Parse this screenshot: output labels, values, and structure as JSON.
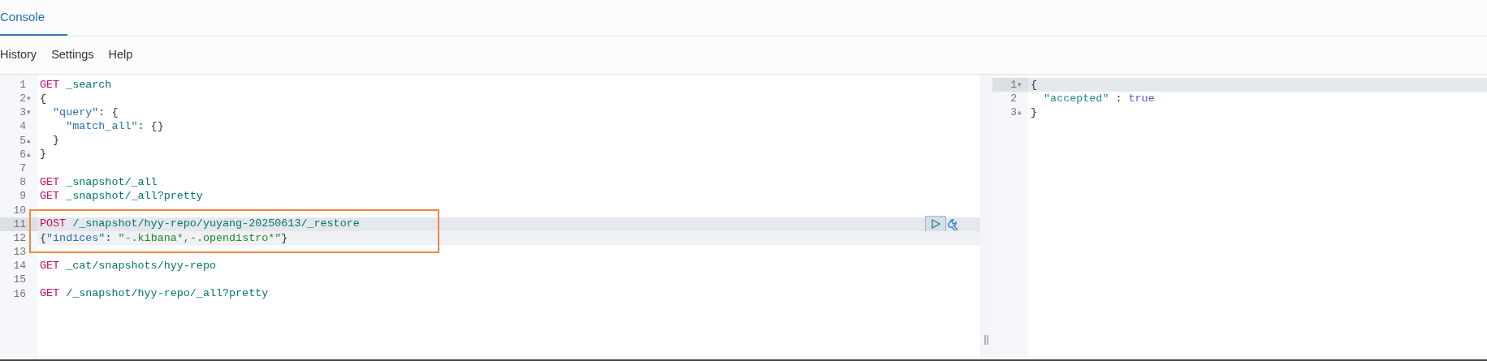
{
  "tabs": [
    {
      "label": "Console",
      "selected": true
    }
  ],
  "menu": [
    "History",
    "Settings",
    "Help"
  ],
  "request_editor": {
    "lines": [
      {
        "number": "1",
        "cursor": false,
        "in_request": false,
        "actions": false,
        "tokens": [
          {
            "kind": "method",
            "text": "GET"
          },
          {
            "kind": "path",
            "text": "_search"
          }
        ]
      },
      {
        "number": "2",
        "fold": "▾",
        "cursor": false,
        "in_request": false,
        "actions": false,
        "tokens": [
          {
            "kind": "punct",
            "text": "{"
          }
        ]
      },
      {
        "number": "3",
        "fold": "▾",
        "cursor": false,
        "in_request": false,
        "actions": false,
        "tokens": [
          {
            "kind": "key",
            "text": "  \"query\""
          },
          {
            "kind": "punct",
            "text": ": {"
          }
        ]
      },
      {
        "number": "4",
        "cursor": false,
        "in_request": false,
        "actions": false,
        "tokens": [
          {
            "kind": "key",
            "text": "    \"match_all\""
          },
          {
            "kind": "punct",
            "text": ": {}"
          }
        ]
      },
      {
        "number": "5",
        "fold": "▴",
        "cursor": false,
        "in_request": false,
        "actions": false,
        "tokens": [
          {
            "kind": "punct",
            "text": "  }"
          }
        ]
      },
      {
        "number": "6",
        "fold": "▴",
        "cursor": false,
        "in_request": false,
        "actions": false,
        "tokens": [
          {
            "kind": "punct",
            "text": "}"
          }
        ]
      },
      {
        "number": "7",
        "cursor": false,
        "in_request": false,
        "actions": false
      },
      {
        "number": "8",
        "cursor": false,
        "in_request": false,
        "actions": false,
        "tokens": [
          {
            "kind": "method",
            "text": "GET"
          },
          {
            "kind": "path",
            "text": "_snapshot/_all"
          }
        ]
      },
      {
        "number": "9",
        "cursor": false,
        "in_request": false,
        "actions": false,
        "tokens": [
          {
            "kind": "method",
            "text": "GET"
          },
          {
            "kind": "path",
            "text": "_snapshot/_all?pretty"
          }
        ]
      },
      {
        "number": "10",
        "cursor": false,
        "in_request": false,
        "actions": false
      },
      {
        "number": "11",
        "cursor": true,
        "in_request": true,
        "actions": true,
        "tokens": [
          {
            "kind": "method",
            "text": "POST"
          },
          {
            "kind": "path",
            "text": "/_snapshot/hyy-repo/yuyang-20250613/_restore"
          }
        ]
      },
      {
        "number": "12",
        "cursor": false,
        "in_request": true,
        "actions": false,
        "tokens": [
          {
            "kind": "punct",
            "text": "{"
          },
          {
            "kind": "key",
            "text": "\"indices\""
          },
          {
            "kind": "punct",
            "text": ": "
          },
          {
            "kind": "string",
            "text": "\"-.kibana*,-.opendistro*\""
          },
          {
            "kind": "punct",
            "text": "}"
          }
        ]
      },
      {
        "number": "13",
        "cursor": false,
        "in_request": false,
        "actions": false
      },
      {
        "number": "14",
        "cursor": false,
        "in_request": false,
        "actions": false,
        "tokens": [
          {
            "kind": "method",
            "text": "GET"
          },
          {
            "kind": "path",
            "text": "_cat/snapshots/hyy-repo"
          }
        ]
      },
      {
        "number": "15",
        "cursor": false,
        "in_request": false,
        "actions": false
      },
      {
        "number": "16",
        "cursor": false,
        "in_request": false,
        "actions": false,
        "tokens": [
          {
            "kind": "method",
            "text": "GET"
          },
          {
            "kind": "path",
            "text": "/_snapshot/hyy-repo/_all?pretty"
          }
        ]
      }
    ]
  },
  "response_viewer": {
    "lines": [
      {
        "number": "1",
        "fold": "▾",
        "cursor": true,
        "tokens": [
          {
            "kind": "punct",
            "text": "{"
          }
        ]
      },
      {
        "number": "2",
        "cursor": false,
        "tokens": [
          {
            "kind": "rkey",
            "text": "  \"accepted\""
          },
          {
            "kind": "punct",
            "text": " : "
          },
          {
            "kind": "bool",
            "text": "true"
          }
        ]
      },
      {
        "number": "3",
        "fold": "▴",
        "cursor": false,
        "tokens": [
          {
            "kind": "punct",
            "text": "}"
          }
        ]
      }
    ]
  }
}
